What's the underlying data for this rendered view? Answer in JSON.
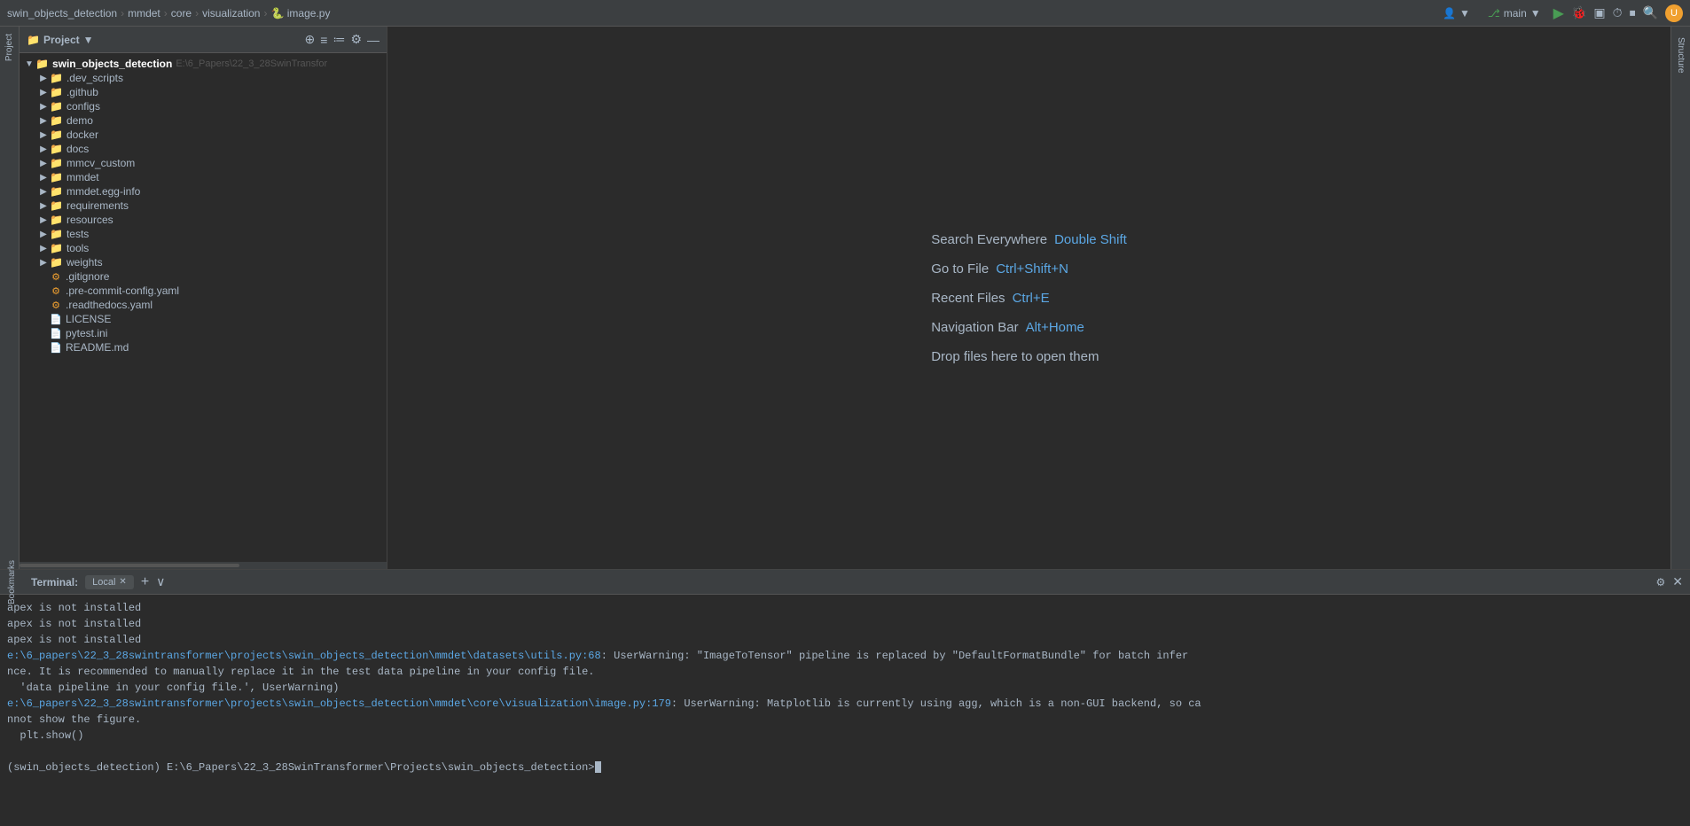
{
  "topbar": {
    "breadcrumbs": [
      {
        "label": "swin_objects_detection",
        "sep": "›"
      },
      {
        "label": "mmdet",
        "sep": "›"
      },
      {
        "label": "core",
        "sep": "›"
      },
      {
        "label": "visualization",
        "sep": "›"
      },
      {
        "label": "🐍 image.py",
        "sep": ""
      }
    ],
    "branch": "main",
    "run_icon": "▶",
    "search_icon": "🔍",
    "user_icon": "U"
  },
  "project": {
    "title": "Project",
    "root_name": "swin_objects_detection",
    "root_path": "E:\\6_Papers\\22_3_28SwinTransfor",
    "items": [
      {
        "name": ".dev_scripts",
        "type": "folder",
        "indent": 1
      },
      {
        "name": ".github",
        "type": "folder",
        "indent": 1
      },
      {
        "name": "configs",
        "type": "folder",
        "indent": 1
      },
      {
        "name": "demo",
        "type": "folder",
        "indent": 1
      },
      {
        "name": "docker",
        "type": "folder",
        "indent": 1
      },
      {
        "name": "docs",
        "type": "folder",
        "indent": 1
      },
      {
        "name": "mmcv_custom",
        "type": "folder",
        "indent": 1
      },
      {
        "name": "mmdet",
        "type": "folder",
        "indent": 1
      },
      {
        "name": "mmdet.egg-info",
        "type": "folder",
        "indent": 1
      },
      {
        "name": "requirements",
        "type": "folder",
        "indent": 1
      },
      {
        "name": "resources",
        "type": "folder",
        "indent": 1
      },
      {
        "name": "tests",
        "type": "folder",
        "indent": 1
      },
      {
        "name": "tools",
        "type": "folder",
        "indent": 1
      },
      {
        "name": "weights",
        "type": "folder",
        "indent": 1
      },
      {
        "name": ".gitignore",
        "type": "file-git",
        "indent": 1
      },
      {
        "name": ".pre-commit-config.yaml",
        "type": "file-yaml",
        "indent": 1
      },
      {
        "name": ".readthedocs.yaml",
        "type": "file-yaml",
        "indent": 1
      },
      {
        "name": "LICENSE",
        "type": "file",
        "indent": 1
      },
      {
        "name": "pytest.ini",
        "type": "file-ini",
        "indent": 1
      },
      {
        "name": "README.md",
        "type": "file-md",
        "indent": 1
      }
    ]
  },
  "left_tabs": [
    "Project"
  ],
  "right_tabs": [
    "Structure"
  ],
  "bottom_tabs": [
    "Bookmarks"
  ],
  "editor": {
    "hints": [
      {
        "label": "Search Everywhere",
        "shortcut": "Double Shift"
      },
      {
        "label": "Go to File",
        "shortcut": "Ctrl+Shift+N"
      },
      {
        "label": "Recent Files",
        "shortcut": "Ctrl+E"
      },
      {
        "label": "Navigation Bar",
        "shortcut": "Alt+Home"
      },
      {
        "label": "Drop files here to open them",
        "shortcut": ""
      }
    ]
  },
  "terminal": {
    "label": "Terminal:",
    "tab_label": "Local",
    "add_label": "+",
    "more_label": "∨",
    "lines": [
      {
        "text": "apex is not installed",
        "type": "plain"
      },
      {
        "text": "apex is not installed",
        "type": "plain"
      },
      {
        "text": "apex is not installed",
        "type": "plain"
      },
      {
        "text": "e:\\6_papers\\22_3_28swintransformer\\projects\\swin_objects_detection\\mmdet\\datasets\\utils.py:68",
        "type": "link",
        "suffix": ": UserWarning: \"ImageToTensor\" pipeline is replaced by \"DefaultFormatBundle\" for batch infer\nce. It is recommended to manually replace it in the test data pipeline in your config file."
      },
      {
        "text": "  'data pipeline in your config file.', UserWarning)",
        "type": "plain"
      },
      {
        "text": "e:\\6_papers\\22_3_28swintransformer\\projects\\swin_objects_detection\\mmdet\\core\\visualization\\image.py:179",
        "type": "link",
        "suffix": ": UserWarning: Matplotlib is currently using agg, which is a non-GUI backend, so ca\nnot show the figure."
      },
      {
        "text": "  plt.show()",
        "type": "plain"
      }
    ],
    "prompt": "(swin_objects_detection) E:\\6_Papers\\22_3_28SwinTransformer\\Projects\\swin_objects_detection>"
  }
}
